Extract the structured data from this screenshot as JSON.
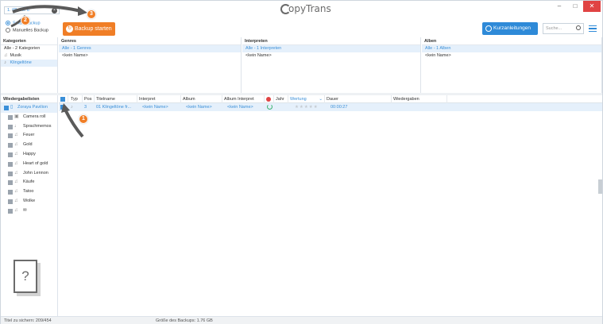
{
  "titlebar": {
    "device": "1. iPhone 6",
    "brand": "opyTrans",
    "minimize": "–",
    "maximize": "□",
    "close": "✕"
  },
  "toolbar": {
    "smart_backup": "Smart Backup",
    "manual_backup": "Manuelles Backup",
    "backup_button": "Backup starten",
    "guide_button": "Kurzanleitungen",
    "search_placeholder": "Suche..."
  },
  "kategorien": {
    "header": "Kategorien",
    "items": [
      "Alle - 2 Kategorien",
      "Musik",
      "Klingeltöne"
    ]
  },
  "genres": {
    "header": "Genres",
    "items": [
      "Alle - 1 Genres",
      "<kein Name>"
    ]
  },
  "interpreten": {
    "header": "Interpreten",
    "items": [
      "Alle - 1 Interpreten",
      "<kein Name>"
    ]
  },
  "alben": {
    "header": "Alben",
    "items": [
      "Alle - 1 Alben",
      "<kein Name>"
    ]
  },
  "playlists": {
    "header": "Wiedergabelisten",
    "device": "Zoraya Pavilion",
    "items": [
      "Camera roll",
      "Sprachmemos",
      "Feuer",
      "Gold",
      "Happy",
      "Heart of gold",
      "John Lennon",
      "Käufe",
      "Tatoo",
      "Wolke",
      "✉"
    ]
  },
  "table": {
    "columns": {
      "typ": "Typ",
      "pos": "Pos",
      "title": "Titelname",
      "artist": "Interpret",
      "album": "Album",
      "album_artist": "Album Interpret",
      "year": "Jahr",
      "rating": "Wertung",
      "duration": "Dauer",
      "plays": "Wiedergaben"
    },
    "rows": [
      {
        "pos": "3",
        "title": "01 Klingeltöne fr...",
        "artist": "<kein Name>",
        "album": "<kein Name>",
        "album_artist": "<kein Name>",
        "rating": "★★★★★",
        "duration": "00:00:27"
      }
    ]
  },
  "status": {
    "left": "Titel zu sichern: 209/454",
    "mid": "Größe des Backups: 1.76 GB"
  },
  "annotations": [
    "1",
    "2",
    "3"
  ],
  "colors": {
    "accent": "#3a8fd8",
    "backup_orange": "#f07e26",
    "selection": "#e5f0fb"
  }
}
